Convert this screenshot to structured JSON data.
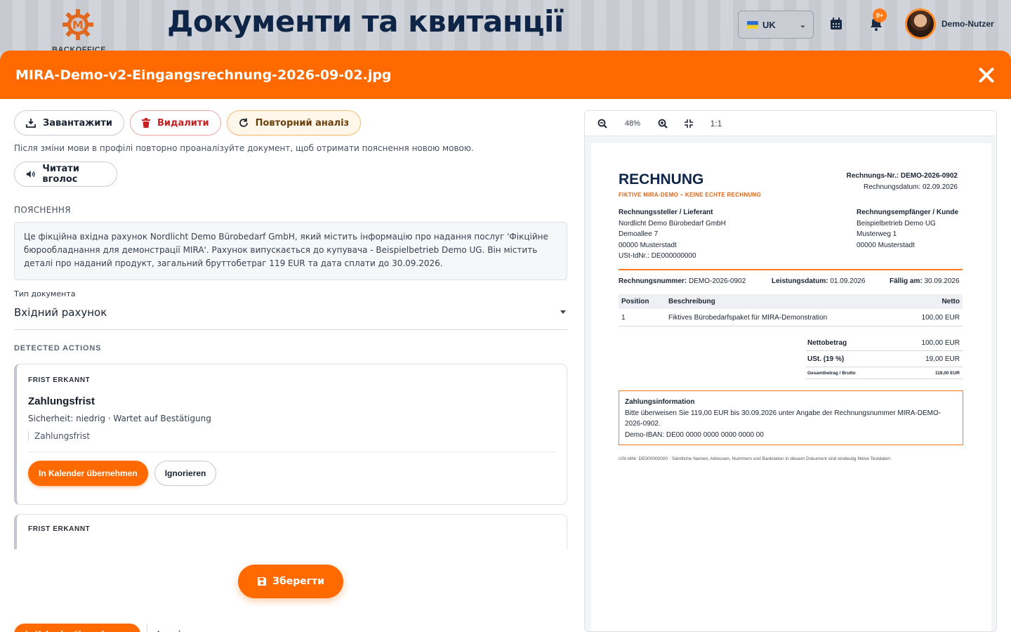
{
  "app": {
    "page_title": "Документи та квитанції",
    "logo_letter": "M",
    "logo_text": "BACKOFFICE",
    "language": "UK",
    "notification_count": "9+",
    "user_name": "Demo-Nutzer"
  },
  "modal": {
    "title": "MIRA-Demo-v2-Eingangsrechnung-2026-09-02.jpg",
    "download_label": "Завантажити",
    "delete_label": "Видалити",
    "reanalyze_label": "Повторний аналіз",
    "reanalyze_note": "Після зміни мови в профілі повторно проаналізуйте документ, щоб отримати пояснення новою мовою.",
    "read_aloud_label": "Читати вголос",
    "explanation_label": "ПОЯСНЕННЯ",
    "explanation_text": "Це фікційна вхідна рахунок Nordlicht Demo Bürobedarf GmbH, який містить інформацію про надання послуг 'Фікційне бюрообладнання для демонстрації MIRA'. Рахунок випускається до купувача - Beispielbetrieb Demo UG. Він містить деталі про наданий продукт, загальний бруттобетраг 119 EUR та дата сплати до 30.09.2026.",
    "doc_type_label": "Тип документа",
    "doc_type_value": "Вхідний рахунок",
    "detected_label": "DETECTED ACTIONS",
    "save_label": "Зберегти"
  },
  "actions": [
    {
      "tag": "FRIST ERKANNT",
      "title": "Zahlungsfrist",
      "meta": "Sicherheit: niedrig · Wartet auf Bestätigung",
      "quote": "Zahlungsfrist",
      "accept_label": "In Kalender übernehmen",
      "ignore_label": "Ignorieren"
    },
    {
      "tag": "FRIST ERKANNT",
      "accept_label": "In Kalender übernehmen",
      "ignore_label": "Ignorieren"
    }
  ],
  "viewer": {
    "zoom": "48%",
    "reset_label": "1:1"
  },
  "invoice": {
    "title": "RECHNUNG",
    "subtitle": "FIKTIVE MIRA-DEMO – KEINE ECHTE RECHNUNG",
    "nr_label": "Rechnungs-Nr.:",
    "nr_value": "DEMO-2026-0902",
    "date_line": "Rechnungsdatum: 02.09.2026",
    "seller_heading": "Rechnungssteller / Lieferant",
    "seller_lines": [
      "Nordlicht Demo Bürobedarf GmbH",
      "Demoallee 7",
      "00000 Musterstadt",
      "USt-IdNr.: DE000000000"
    ],
    "buyer_heading": "Rechnungsempfänger / Kunde",
    "buyer_lines": [
      "Beispielbetrieb Demo UG",
      "Musterweg 1",
      "00000 Musterstadt"
    ],
    "meta_nr_label": "Rechnungsnummer:",
    "meta_nr": "DEMO-2026-0902",
    "meta_ld_label": "Leistungsdatum:",
    "meta_ld": "01.09.2026",
    "meta_due_label": "Fällig am:",
    "meta_due": "30.09.2026",
    "table_headers": [
      "Position",
      "Beschreibung",
      "Netto"
    ],
    "rows": [
      [
        "1",
        "Fiktives Bürobedarfspaket für MIRA-Demonstration",
        "100,00 EUR"
      ]
    ],
    "totals": [
      [
        "Nettobetrag",
        "100,00 EUR"
      ],
      [
        "USt. (19 %)",
        "19,00 EUR"
      ],
      [
        "Gesamtbetrag / Brutto",
        "119,00 EUR"
      ]
    ],
    "pay_heading": "Zahlungsinformation",
    "pay_text": "Bitte überweisen Sie 119,00 EUR bis 30.09.2026 unter Angabe der Rechnungsnummer MIRA-DEMO-2026-0902.",
    "pay_iban": "Demo-IBAN: DE00 0000 0000 0000 0000 00",
    "footer": "USt-IdNr. DE000000000 · Sämtliche Namen, Adressen, Nummern und Bankdaten in diesem Dokument sind eindeutig fiktive Testdaten."
  },
  "colors": {
    "accent": "#ff6a00",
    "navy": "#0f2547"
  }
}
